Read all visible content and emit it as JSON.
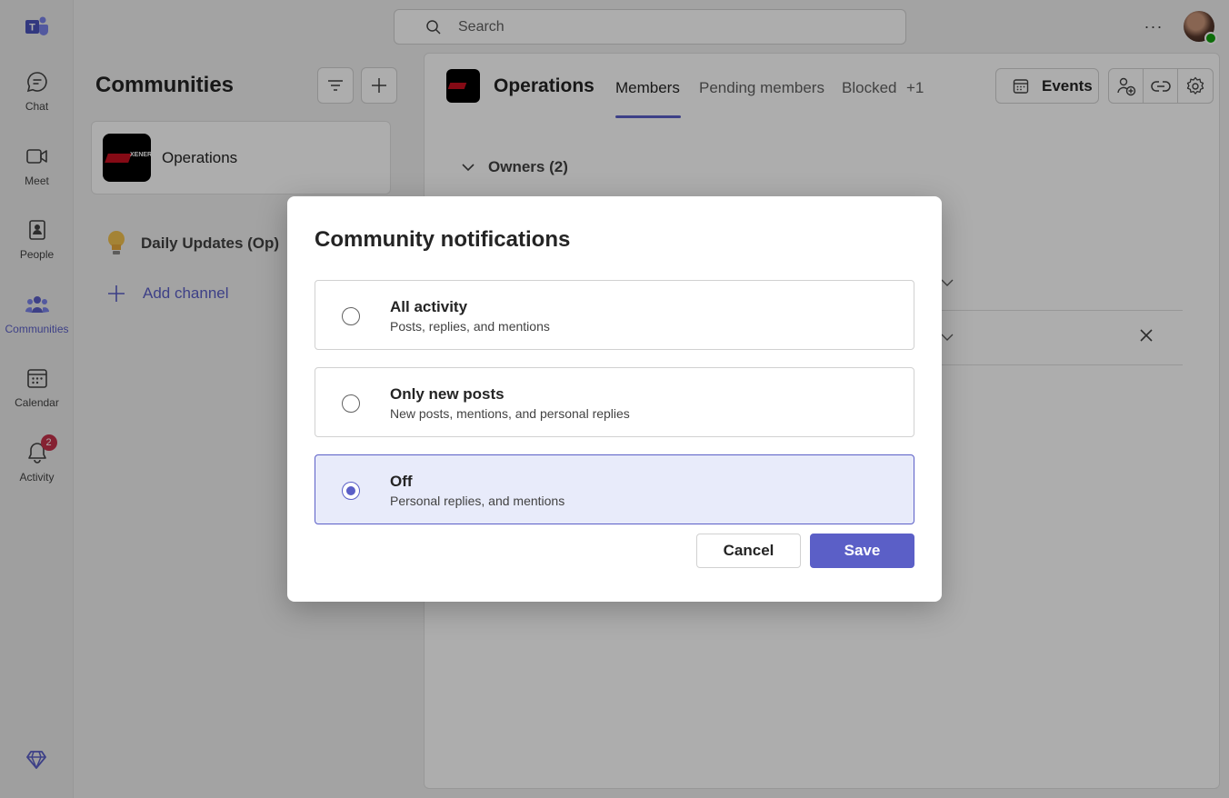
{
  "rail": {
    "items": [
      {
        "label": "Chat",
        "icon": "chat-icon"
      },
      {
        "label": "Meet",
        "icon": "video-icon"
      },
      {
        "label": "People",
        "icon": "people-icon"
      },
      {
        "label": "Communities",
        "icon": "communities-icon"
      },
      {
        "label": "Calendar",
        "icon": "calendar-icon"
      },
      {
        "label": "Activity",
        "icon": "bell-icon",
        "badge": "2"
      }
    ]
  },
  "search": {
    "placeholder": "Search"
  },
  "left_panel": {
    "title": "Communities",
    "community_name": "Operations",
    "channel_name": "Daily Updates (Op)",
    "add_channel_label": "Add channel"
  },
  "main": {
    "title": "Operations",
    "tabs": [
      {
        "label": "Members"
      },
      {
        "label": "Pending members"
      },
      {
        "label": "Blocked"
      },
      {
        "label": "+1"
      }
    ],
    "events_label": "Events",
    "owners_label": "Owners (2)"
  },
  "dialog": {
    "title": "Community notifications",
    "options": [
      {
        "title": "All activity",
        "subtitle": "Posts, replies, and mentions",
        "selected": false
      },
      {
        "title": "Only new posts",
        "subtitle": "New posts, mentions, and personal replies",
        "selected": false
      },
      {
        "title": "Off",
        "subtitle": "Personal replies, and mentions",
        "selected": true
      }
    ],
    "cancel_label": "Cancel",
    "save_label": "Save"
  },
  "colors": {
    "accent": "#5b5fc7",
    "selected_bg": "#e8ebfa",
    "badge": "#c4314b"
  }
}
